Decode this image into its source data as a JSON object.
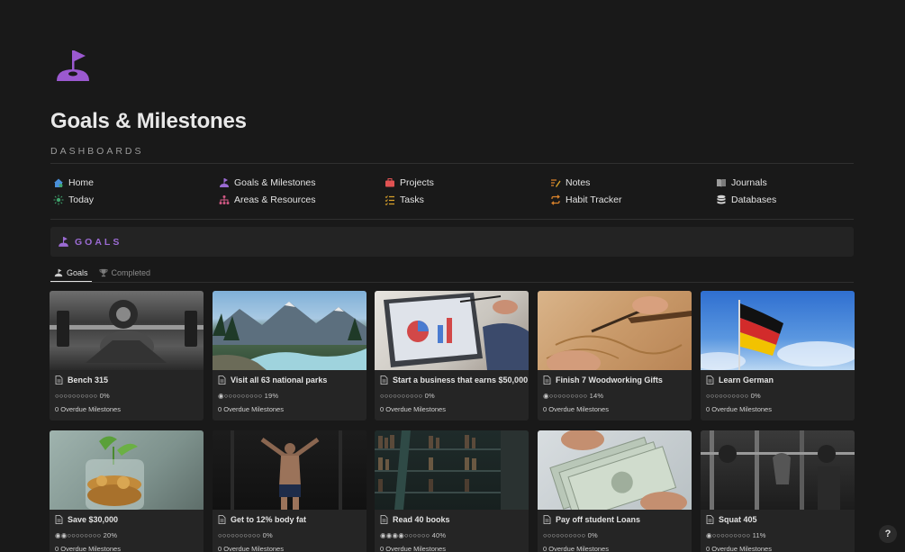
{
  "page": {
    "title": "Goals & Milestones",
    "icon": "flag-pin-icon",
    "section_label": "DASHBOARDS"
  },
  "nav": [
    {
      "label": "Home",
      "icon": "house-icon",
      "color": "#4a8fd9"
    },
    {
      "label": "Goals & Milestones",
      "icon": "flag-pin-icon",
      "color": "#9b6bd3"
    },
    {
      "label": "Projects",
      "icon": "briefcase-icon",
      "color": "#e05252"
    },
    {
      "label": "Notes",
      "icon": "pencil-lines-icon",
      "color": "#d9822b"
    },
    {
      "label": "Journals",
      "icon": "book-icon",
      "color": "#9b9b9b"
    },
    {
      "label": "Today",
      "icon": "sun-icon",
      "color": "#3fa26b"
    },
    {
      "label": "Areas & Resources",
      "icon": "hierarchy-icon",
      "color": "#d45a86"
    },
    {
      "label": "Tasks",
      "icon": "checklist-icon",
      "color": "#d9a12b"
    },
    {
      "label": "Habit Tracker",
      "icon": "repeat-icon",
      "color": "#d9822b"
    },
    {
      "label": "Databases",
      "icon": "database-icon",
      "color": "#d4d4d4"
    }
  ],
  "goals_section": {
    "label": "GOALS",
    "icon": "flag-pin-icon"
  },
  "tabs": [
    {
      "label": "Goals",
      "icon": "flag-pin-icon",
      "active": true
    },
    {
      "label": "Completed",
      "icon": "trophy-icon",
      "active": false
    }
  ],
  "cards": [
    {
      "title": "Bench 315",
      "dots": "○○○○○○○○○○",
      "percent": "0%",
      "overdue": "0 Overdue Milestones",
      "image": "bench-press-photo"
    },
    {
      "title": "Visit all 63 national parks",
      "dots": "◉○○○○○○○○○",
      "percent": "19%",
      "overdue": "0 Overdue Milestones",
      "image": "mountain-river-photo"
    },
    {
      "title": "Start a business that earns $50,000",
      "dots": "○○○○○○○○○○",
      "percent": "0%",
      "overdue": "0 Overdue Milestones",
      "image": "laptop-chart-photo"
    },
    {
      "title": "Finish 7 Woodworking Gifts",
      "dots": "◉○○○○○○○○○",
      "percent": "14%",
      "overdue": "0 Overdue Milestones",
      "image": "wood-carving-photo"
    },
    {
      "title": "Learn German",
      "dots": "○○○○○○○○○○",
      "percent": "0%",
      "overdue": "0 Overdue Milestones",
      "image": "german-flag-photo"
    },
    {
      "title": "Save $30,000",
      "dots": "◉◉○○○○○○○○",
      "percent": "20%",
      "overdue": "0 Overdue Milestones",
      "image": "coin-jar-photo"
    },
    {
      "title": "Get to 12% body fat",
      "dots": "○○○○○○○○○○",
      "percent": "0%",
      "overdue": "0 Overdue Milestones",
      "image": "athlete-gym-photo"
    },
    {
      "title": "Read 40 books",
      "dots": "◉◉◉◉○○○○○○",
      "percent": "40%",
      "overdue": "0 Overdue Milestones",
      "image": "library-shelves-photo"
    },
    {
      "title": "Pay off student Loans",
      "dots": "○○○○○○○○○○",
      "percent": "0%",
      "overdue": "0 Overdue Milestones",
      "image": "dollar-bills-photo"
    },
    {
      "title": "Squat 405",
      "dots": "◉○○○○○○○○○",
      "percent": "11%",
      "overdue": "0 Overdue Milestones",
      "image": "squat-rack-photo"
    }
  ],
  "help": {
    "label": "?"
  }
}
